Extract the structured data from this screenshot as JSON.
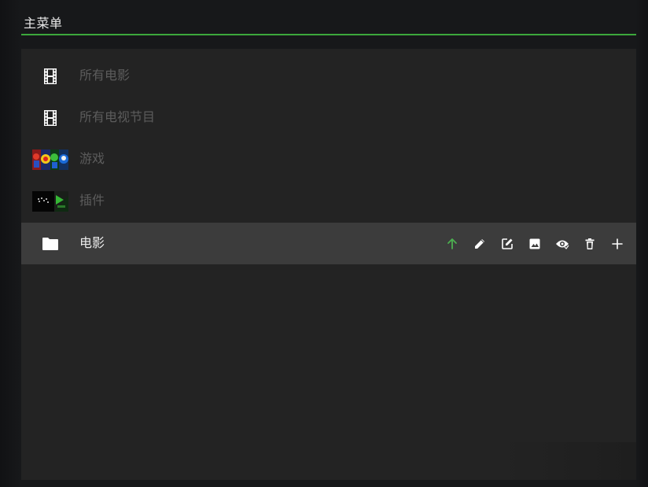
{
  "header": {
    "title": "主菜单",
    "accent_color": "#3ca83c"
  },
  "menu": {
    "items": [
      {
        "label": "所有电影",
        "icon": "film-icon",
        "state": "disabled"
      },
      {
        "label": "所有电视节目",
        "icon": "film-icon",
        "state": "disabled"
      },
      {
        "label": "游戏",
        "icon": "games-thumbnail",
        "state": "disabled"
      },
      {
        "label": "插件",
        "icon": "addons-thumbnail",
        "state": "disabled"
      },
      {
        "label": "电影",
        "icon": "folder-icon",
        "state": "selected"
      }
    ],
    "selected_actions": [
      {
        "name": "move-up",
        "icon": "arrow-up-icon",
        "color": "#4caf50"
      },
      {
        "name": "rename",
        "icon": "pencil-icon",
        "color": "#ffffff"
      },
      {
        "name": "edit",
        "icon": "edit-square-icon",
        "color": "#ffffff"
      },
      {
        "name": "change-image",
        "icon": "image-icon",
        "color": "#ffffff"
      },
      {
        "name": "visibility",
        "icon": "eye-icon",
        "color": "#ffffff"
      },
      {
        "name": "delete",
        "icon": "trash-icon",
        "color": "#ffffff"
      },
      {
        "name": "add",
        "icon": "plus-icon",
        "color": "#ffffff"
      }
    ]
  }
}
